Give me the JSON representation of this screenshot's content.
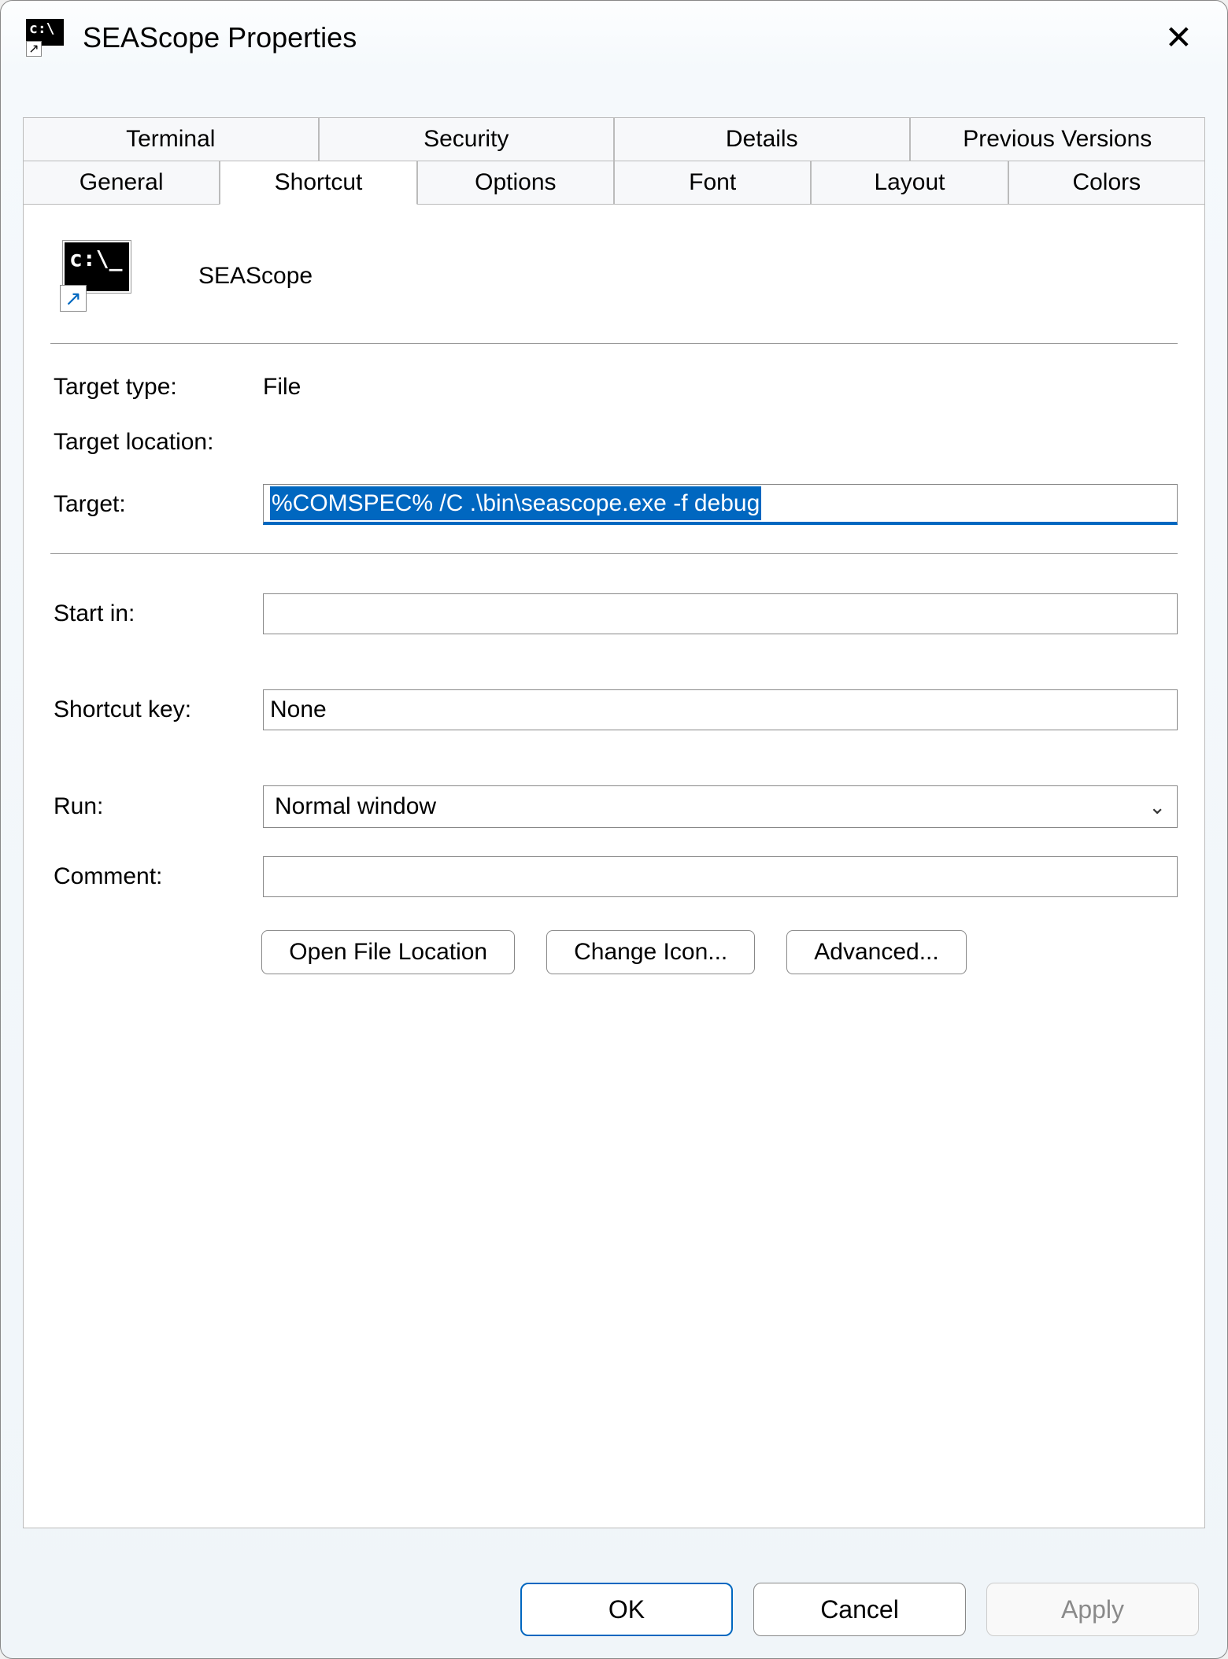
{
  "window": {
    "title": "SEAScope Properties"
  },
  "tabs_row1": [
    "Terminal",
    "Security",
    "Details",
    "Previous Versions"
  ],
  "tabs_row2": [
    "General",
    "Shortcut",
    "Options",
    "Font",
    "Layout",
    "Colors"
  ],
  "active_tab": "Shortcut",
  "shortcut": {
    "app_name": "SEAScope",
    "labels": {
      "target_type": "Target type:",
      "target_location": "Target location:",
      "target": "Target:",
      "start_in": "Start in:",
      "shortcut_key": "Shortcut key:",
      "run": "Run:",
      "comment": "Comment:"
    },
    "values": {
      "target_type": "File",
      "target_location": "",
      "target": "%COMSPEC% /C .\\bin\\seascope.exe -f debug",
      "start_in": "",
      "shortcut_key": "None",
      "run": "Normal window",
      "comment": ""
    },
    "buttons": {
      "open_file_location": "Open File Location",
      "change_icon": "Change Icon...",
      "advanced": "Advanced..."
    }
  },
  "footer": {
    "ok": "OK",
    "cancel": "Cancel",
    "apply": "Apply"
  }
}
